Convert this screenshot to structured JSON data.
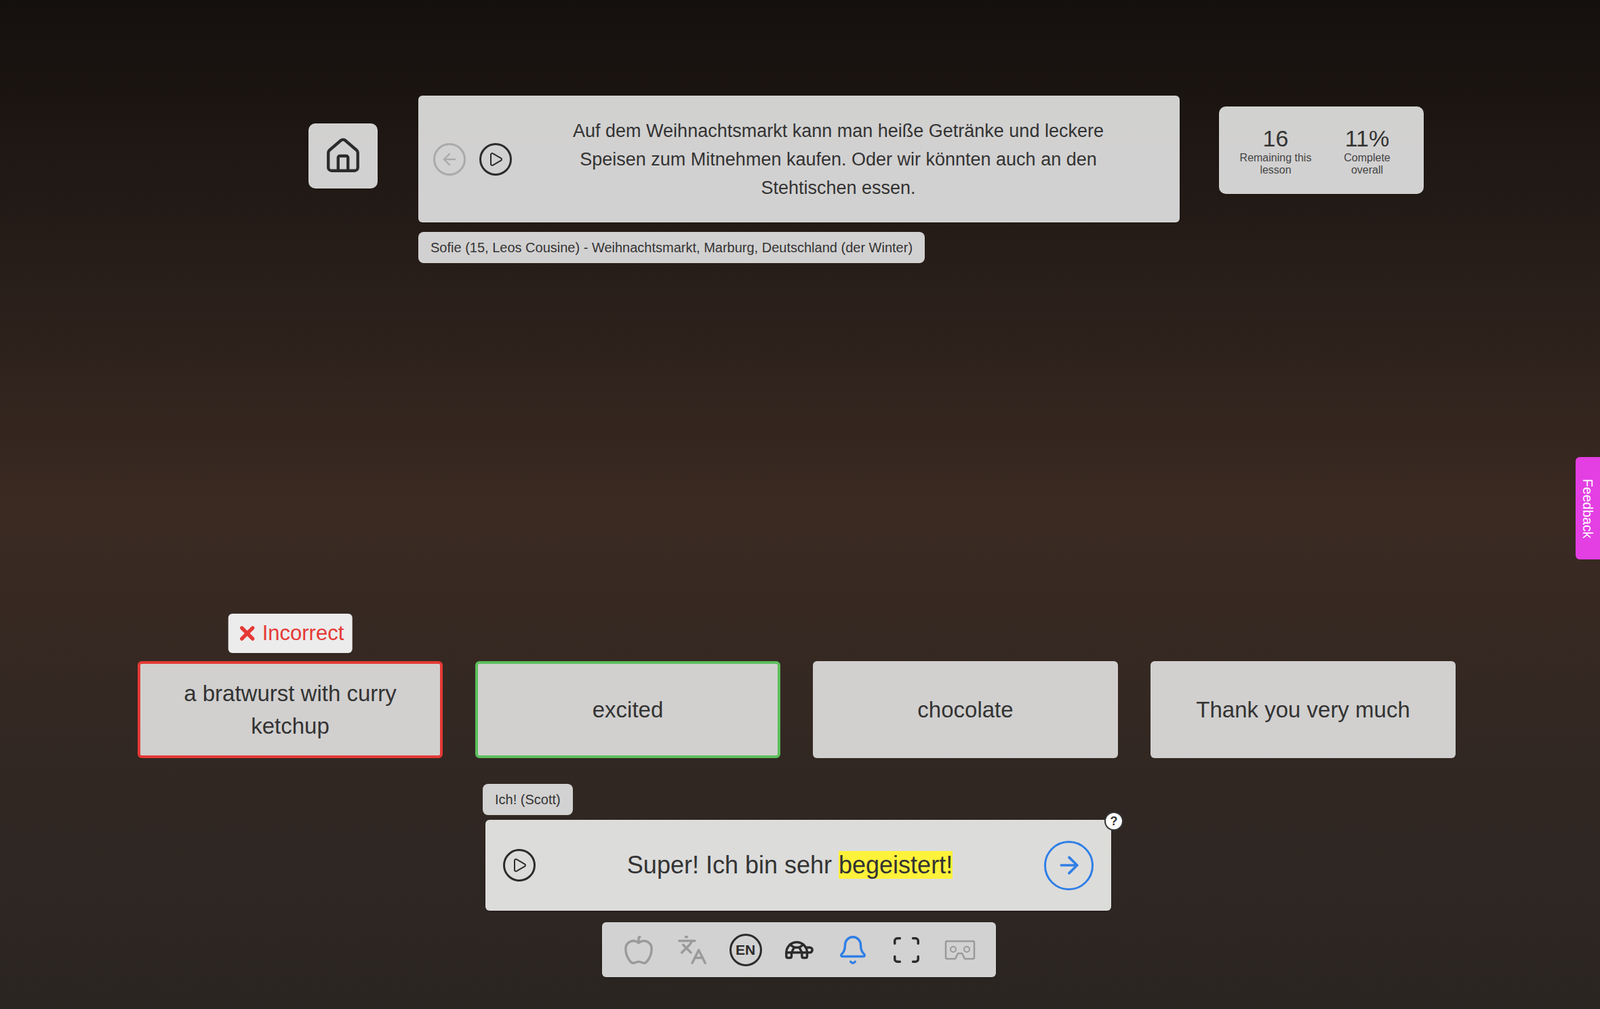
{
  "prompt": {
    "text": "Auf dem Weihnachtsmarkt kann man heiße Getränke und leckere Speisen zum Mitnehmen kaufen. Oder wir könnten auch an den Stehtischen essen.",
    "back_disabled": true,
    "speaker": "Sofie (15, Leos Cousine) - Weihnachtsmarkt, Marburg, Deutschland (der Winter)"
  },
  "stats": [
    {
      "value": "16",
      "label": "Remaining this lesson"
    },
    {
      "value": "11%",
      "label": "Complete overall"
    }
  ],
  "choices": [
    {
      "text": "a bratwurst with curry ketchup",
      "selected": false,
      "incorrect": true,
      "badge": "Incorrect"
    },
    {
      "text": "excited",
      "selected": true,
      "incorrect": false,
      "badge": ""
    },
    {
      "text": "chocolate",
      "selected": false,
      "incorrect": false,
      "badge": ""
    },
    {
      "text": "Thank you very much",
      "selected": false,
      "incorrect": false,
      "badge": ""
    }
  ],
  "response": {
    "speaker": "Ich! (Scott)",
    "segments": [
      {
        "text": "Super! Ich bin sehr",
        "highlighted": false
      },
      {
        "text": "begeistert!",
        "highlighted": true
      }
    ],
    "help": "?"
  },
  "toolbar": [
    {
      "kind": "apple",
      "label": "",
      "enabled": false,
      "active": false
    },
    {
      "kind": "translate",
      "label": "",
      "enabled": false,
      "active": false
    },
    {
      "kind": "language",
      "label": "EN",
      "enabled": true,
      "active": false
    },
    {
      "kind": "turtle",
      "label": "",
      "enabled": true,
      "active": false
    },
    {
      "kind": "bell",
      "label": "",
      "enabled": true,
      "active": true
    },
    {
      "kind": "fullscreen",
      "label": "",
      "enabled": true,
      "active": false
    },
    {
      "kind": "vr",
      "label": "",
      "enabled": false,
      "active": false
    }
  ],
  "feedback_tab": "Feedback"
}
